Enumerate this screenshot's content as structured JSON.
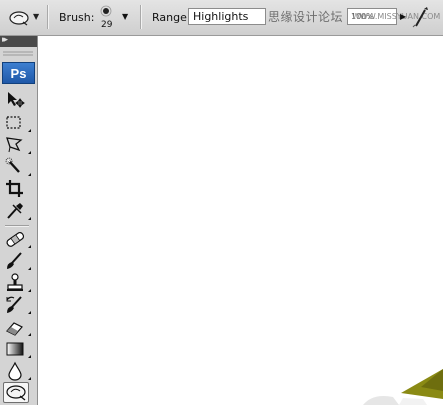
{
  "options_bar": {
    "tool_preset_icon": "dodge-burn-sponge-icon",
    "brush": {
      "label": "Brush:",
      "size": "29"
    },
    "range": {
      "label": "Range:",
      "value": "Highlights"
    },
    "watermark_text": "思缘设计论坛",
    "exposure_value": "100%",
    "watermark_url": "WWW.MISSYUAN.COM",
    "airbrush_icon": "airbrush-icon"
  },
  "tools_panel": {
    "logo": "Ps",
    "tools": [
      {
        "name": "move-tool",
        "icon": "move-icon"
      },
      {
        "name": "marquee-tool",
        "icon": "marquee-icon"
      },
      {
        "name": "lasso-tool",
        "icon": "polygonal-lasso-icon"
      },
      {
        "name": "quick-selection-tool",
        "icon": "magic-wand-icon"
      },
      {
        "name": "crop-tool",
        "icon": "crop-icon"
      },
      {
        "name": "eyedropper-tool",
        "icon": "eyedropper-icon"
      },
      {
        "name": "healing-brush-tool",
        "icon": "bandage-icon"
      },
      {
        "name": "brush-tool",
        "icon": "brush-icon"
      },
      {
        "name": "clone-stamp-tool",
        "icon": "stamp-icon"
      },
      {
        "name": "history-brush-tool",
        "icon": "history-brush-icon"
      },
      {
        "name": "eraser-tool",
        "icon": "eraser-icon"
      },
      {
        "name": "gradient-tool",
        "icon": "gradient-icon"
      },
      {
        "name": "blur-tool",
        "icon": "blur-drop-icon"
      },
      {
        "name": "dodge-tool",
        "icon": "dodge-icon",
        "selected": true
      }
    ]
  },
  "colors": {
    "panel_bg": "#d4d4d4",
    "canvas_bg": "#ffffff",
    "ps_logo": "#2a6bc0",
    "canvas_shape": "#8a8a14"
  }
}
